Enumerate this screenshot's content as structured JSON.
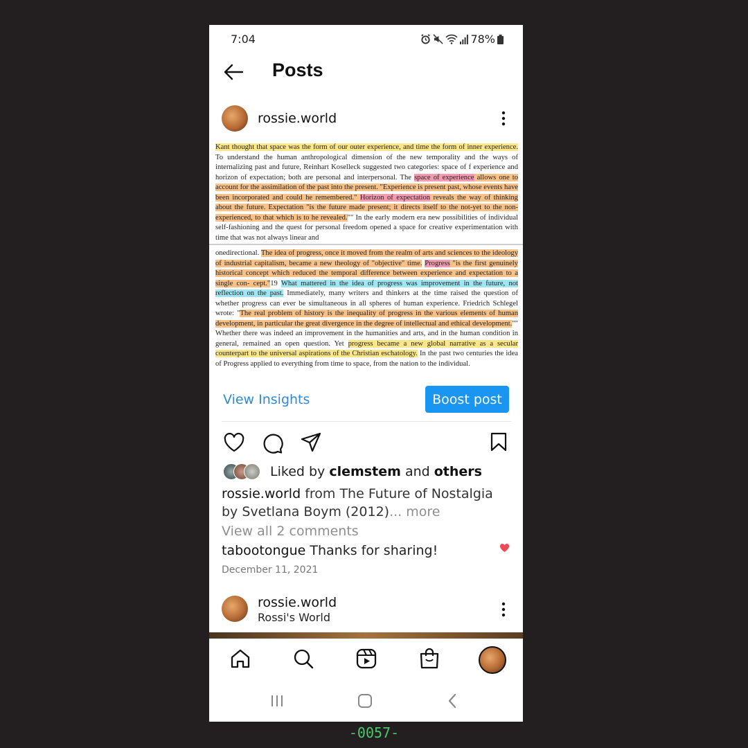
{
  "status_bar": {
    "time": "7:04",
    "battery": "78%"
  },
  "header": {
    "title": "Posts"
  },
  "post": {
    "username": "rossie.world",
    "page_text": {
      "p1": [
        {
          "t": "Kant thought that space was the form of our outer experience, and time the form of inner experience.",
          "h": "y"
        },
        {
          "t": " To understand the human anthropological dimension of the new temporality and the ways of internalizing past and future, Reinhart Koselleck suggested two categories: space of f experience and horizon of expectation; both are personal and interpersonal. The ",
          "h": ""
        },
        {
          "t": "space of experience",
          "h": "p"
        },
        {
          "t": " allows one to account for the assimilation of the past into the present. \"Experience is present past, whose events have been incorporated and could he remembered.\" ",
          "h": "o"
        },
        {
          "t": "Horizon of expectation",
          "h": "p"
        },
        {
          "t": " reveals the way of thinking about the future. Expectation \"is the future made present; it directs itself to the not-yet to the non-experienced, to that which is to he revealed.",
          "h": "o"
        },
        {
          "t": "\"\" In the early modern era new possibilities of individual self-fashioning and the quest for personal freedom opened a space for creative experimentation with time that was not always linear and",
          "h": ""
        }
      ],
      "p2": [
        {
          "t": "onedirectional. ",
          "h": ""
        },
        {
          "t": "The idea of progress, once it moved from the realm of arts and sciences to the ideology of industrial capitalism, became a new theology of \"objective\" time.",
          "h": "o"
        },
        {
          "t": " ",
          "h": ""
        },
        {
          "t": "Progress",
          "h": "p"
        },
        {
          "t": " \"is the first genuinely historical concept which reduced the temporal difference between experience and expectation to a single con- cept.\"",
          "h": "o"
        },
        {
          "t": "19 ",
          "h": ""
        },
        {
          "t": "What mattered in the idea of progress was improvement in the future, not reflection on the past.",
          "h": "c"
        },
        {
          "t": " Immediately, many writers and thinkers at the time raised the question of whether progress can ever be simultaneous in all spheres of human experience. Friedrich Schlegel wrote: \"",
          "h": ""
        },
        {
          "t": "The real problem of history is the inequality of progress in the various elements of human development, in particular the great divergence in the degree of intellectual and ethical development.",
          "h": "o"
        },
        {
          "t": "\"\" Whether there was indeed an improvement in the humanities and arts, and in the human condition in general, remained an open question. Yet ",
          "h": ""
        },
        {
          "t": "progress became a new global narrative as a secular counterpart to the universal aspirations of the Christian eschatology.",
          "h": "y"
        },
        {
          "t": " In the past two centuries the idea of Progress applied to everything from time to space, from the nation to the individual.",
          "h": ""
        }
      ]
    },
    "view_insights": "View Insights",
    "boost_post": "Boost post",
    "liked_prefix": "Liked by",
    "liked_user": "clemstem",
    "liked_and": "and",
    "liked_others": "others",
    "caption_user": "rossie.world",
    "caption_text": "from The Future of Nostalgia by Svetlana Boym (2012)",
    "caption_more": "... more",
    "view_comments": "View all 2 comments",
    "comment_user": "tabootongue",
    "comment_text": "Thanks for sharing!",
    "date": "December 11, 2021"
  },
  "next_post": {
    "username": "rossie.world",
    "subtitle": "Rossi's World"
  },
  "watermark": "-0057-",
  "colors": {
    "accent": "#1a95f2",
    "link": "#2e8ad8",
    "heart": "#ed4956",
    "highlight_yellow": "#fde687",
    "highlight_orange": "#f8c188",
    "highlight_pink": "#f49bb0",
    "highlight_cyan": "#a0e6f2"
  },
  "icons": [
    "back-arrow-icon",
    "more-options-icon",
    "heart-icon",
    "comment-icon",
    "share-icon",
    "bookmark-icon",
    "home-icon",
    "search-icon",
    "reels-icon",
    "shop-icon",
    "profile-avatar",
    "recents-icon",
    "home-button-icon",
    "system-back-icon"
  ]
}
